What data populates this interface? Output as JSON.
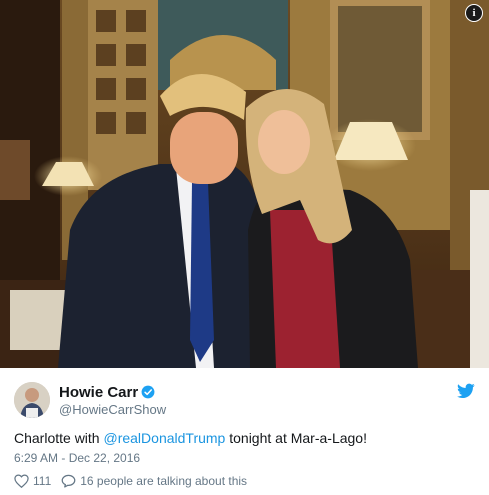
{
  "embed": {
    "info_icon": "info-icon",
    "photo_icon": "photo"
  },
  "tweet": {
    "author_name": "Howie Carr",
    "verified_icon": "verified-badge-icon",
    "handle": "@HowieCarrShow",
    "text_prefix": "Charlotte with ",
    "mention": "@realDonaldTrump",
    "text_suffix": " tonight at Mar-a-Lago!",
    "timestamp": "6:29 AM - Dec 22, 2016",
    "likes": "111",
    "replies_text": "16 people are talking about this",
    "brand_icon": "twitter-bird-icon",
    "link_color": "#1b95e0",
    "brand_color": "#1da1f2"
  }
}
